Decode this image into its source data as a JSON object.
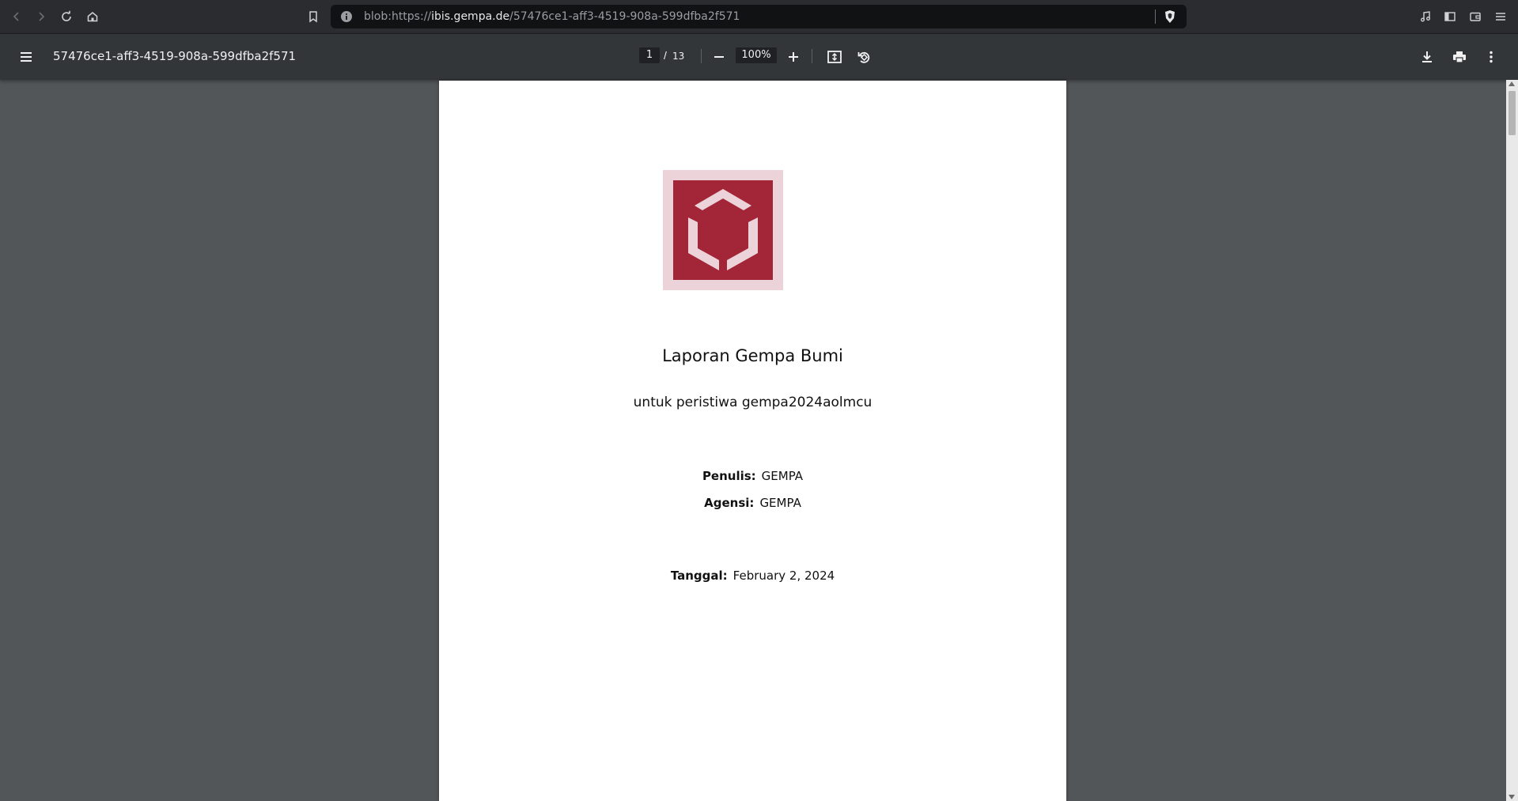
{
  "browser": {
    "url_prefix": "blob:https://",
    "url_host": "ibis.gempa.de",
    "url_path": "/57476ce1-aff3-4519-908a-599dfba2f571"
  },
  "toolbar": {
    "title": "57476ce1-aff3-4519-908a-599dfba2f571",
    "page_current": "1",
    "page_separator": "/",
    "page_total": "13",
    "zoom": "100%"
  },
  "document": {
    "title": "Laporan Gempa Bumi",
    "subtitle": "untuk peristiwa gempa2024aolmcu",
    "author_label": "Penulis:",
    "author_value": "GEMPA",
    "agency_label": "Agensi:",
    "agency_value": "GEMPA",
    "date_label": "Tanggal:",
    "date_value": "February 2, 2024"
  },
  "colors": {
    "logo_red": "#a32638",
    "logo_pink": "#ecd3da",
    "toolbar_bg": "#323639",
    "viewer_bg": "#525659"
  }
}
